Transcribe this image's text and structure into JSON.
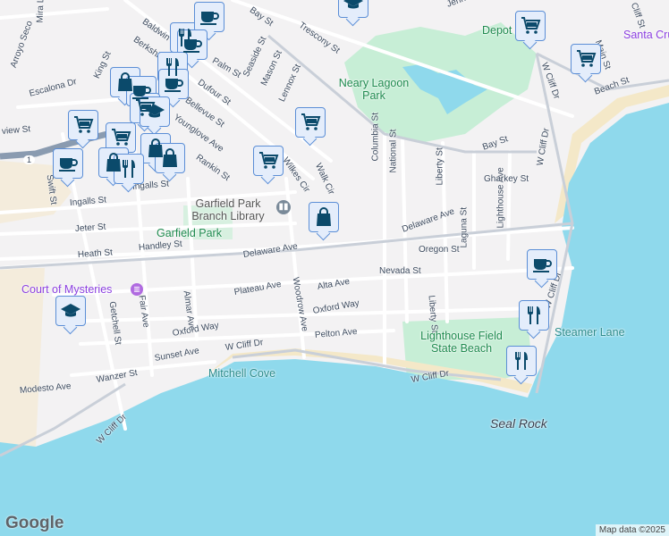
{
  "streets": [
    "Mira L",
    "Arroyo Seco",
    "Escalona Dr",
    "King St",
    "Baldwin St",
    "Berkshire",
    "Palm St",
    "Seaside St",
    "Mason St",
    "Lennox St",
    "Dufour St",
    "Bellevue St",
    "Younglove Ave",
    "Rankin St",
    "Wilkes Cir",
    "Walk Cir",
    "Bay St",
    "Trescony St",
    "view St",
    "Swift St",
    "Ingalls St",
    "Ingalls St",
    "Jeter St",
    "Heath St",
    "Handley St",
    "Delaware Ave",
    "Delaware Ave",
    "Columbia St",
    "National St",
    "Liberty St",
    "Laguna St",
    "Lighthouse Ave",
    "Gharkey St",
    "Oregon St",
    "Nevada St",
    "Liberty St",
    "Plateau Ave",
    "Alta Ave",
    "Woodrow Ave",
    "Oxford Way",
    "Oxford Way",
    "Pelton Ave",
    "Sunset Ave",
    "W Cliff Dr",
    "W Cliff Dr",
    "W Cliff Dr",
    "Almar Ave",
    "Fair Ave",
    "Getchell St",
    "Wanzer St",
    "Modesto Ave",
    "W Cliff Dr",
    "W Cliff Dr",
    "W Cliff Dr",
    "Bay St",
    "Main St",
    "Beach St",
    "Cliff St",
    "Jenne St"
  ],
  "places": {
    "library": "Garfield Park Branch Library",
    "garfield_park": "Garfield Park",
    "court": "Court of Mysteries",
    "mitchell": "Mitchell Cove",
    "lighthouse": "Lighthouse Field State Beach",
    "steamer": "Steamer Lane",
    "seal_rock": "Seal Rock",
    "depot": "Depot",
    "santa_cruz": "Santa Cruz B",
    "neary": "Neary Lagoon Park",
    "highway": "1"
  },
  "markers": [
    "shopping-cart",
    "shopping-cart",
    "shopping-cart",
    "shopping-cart",
    "shopping-cart",
    "shopping-cart",
    "coffee",
    "coffee",
    "coffee",
    "coffee",
    "coffee",
    "shopping-bag",
    "shopping-bag",
    "shopping-bag",
    "shopping-bag",
    "restaurant",
    "restaurant",
    "restaurant",
    "school",
    "school"
  ],
  "footer": {
    "logo": "Google",
    "attribution": "Map data ©2025"
  },
  "colors": {
    "water": "#8fd9ec",
    "park": "#c7eed6",
    "beach": "#f4e8c8",
    "marker_bg": "#e4edfb",
    "marker_icon": "#0b4a6b"
  }
}
